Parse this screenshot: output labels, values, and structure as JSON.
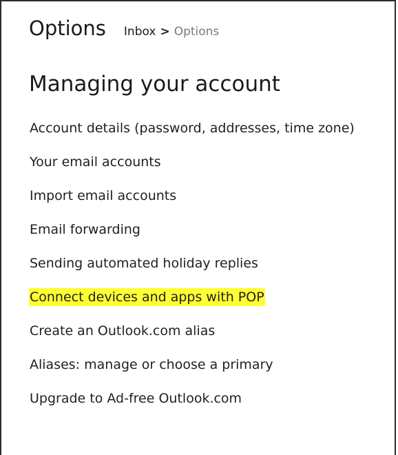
{
  "header": {
    "title": "Options",
    "breadcrumb": {
      "inbox": "Inbox",
      "separator": ">",
      "current": "Options"
    }
  },
  "section": {
    "title": "Managing your account",
    "items": [
      {
        "label": "Account details (password, addresses, time zone)",
        "highlighted": false
      },
      {
        "label": "Your email accounts",
        "highlighted": false
      },
      {
        "label": "Import email accounts",
        "highlighted": false
      },
      {
        "label": "Email forwarding",
        "highlighted": false
      },
      {
        "label": "Sending automated holiday replies",
        "highlighted": false
      },
      {
        "label": "Connect devices and apps with POP",
        "highlighted": true
      },
      {
        "label": "Create an Outlook.com alias",
        "highlighted": false
      },
      {
        "label": "Aliases: manage or choose a primary",
        "highlighted": false
      },
      {
        "label": "Upgrade to Ad-free Outlook.com",
        "highlighted": false
      }
    ]
  },
  "colors": {
    "highlight": "#ffff33",
    "breadcrumb_current": "#7a7a7a",
    "border": "#2b2b2b"
  }
}
